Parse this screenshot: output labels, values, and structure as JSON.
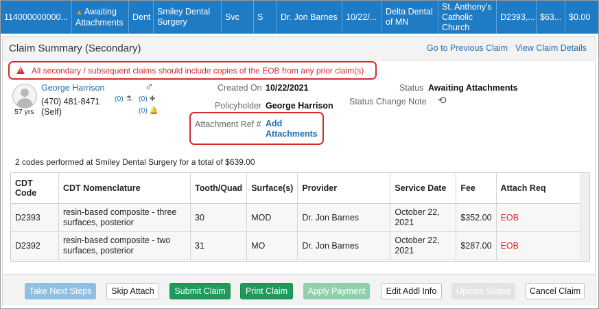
{
  "header_row": {
    "claim_no": "114000000000...",
    "status": "Awaiting Attachments",
    "type": "Dent",
    "office": "Smiley Dental Surgery",
    "svc": "Svc",
    "s": "S",
    "provider": "Dr. Jon Barnes",
    "date": "10/22/...",
    "payer": "Delta Dental of MN",
    "facility": "St. Anthony's Catholic Church",
    "codes": "D2393,...",
    "amount": "$63...",
    "balance": "$0.00"
  },
  "panel": {
    "title": "Claim Summary (Secondary)",
    "prev_link": "Go to Previous Claim",
    "details_link": "View Claim Details"
  },
  "alert": {
    "text": "All secondary / subsequent claims should include copies of the EOB from any prior claim(s)"
  },
  "patient": {
    "name": "George Harrison",
    "phone": "(470) 481-8471",
    "relation": "(Self)",
    "age": "57 yrs",
    "count1": "(0)",
    "count2": "(0)",
    "count3": "(0)",
    "gender_symbol": "♂"
  },
  "claim_info": {
    "created_label": "Created On",
    "created_value": "10/22/2021",
    "policyholder_label": "Policyholder",
    "policyholder_value": "George Harrison",
    "attachment_label": "Attachment Ref #",
    "add_attachments": "Add Attachments",
    "status_label": "Status",
    "status_value": "Awaiting Attachments",
    "status_note_label": "Status Change Note"
  },
  "summary_text": "2 codes performed at Smiley Dental Surgery for a total of $639.00",
  "table": {
    "headers": [
      "CDT Code",
      "CDT Nomenclature",
      "Tooth/Quad",
      "Surface(s)",
      "Provider",
      "Service Date",
      "Fee",
      "Attach Req"
    ],
    "rows": [
      [
        "D2393",
        "resin-based composite - three surfaces, posterior",
        "30",
        "MOD",
        "Dr. Jon Barnes",
        "October 22, 2021",
        "$352.00",
        "EOB"
      ],
      [
        "D2392",
        "resin-based composite - two surfaces, posterior",
        "31",
        "MO",
        "Dr. Jon Barnes",
        "October 22, 2021",
        "$287.00",
        "EOB"
      ]
    ]
  },
  "buttons": {
    "next_steps": "Take Next Steps",
    "skip_attach": "Skip Attach",
    "submit_claim": "Submit Claim",
    "print_claim": "Print Claim",
    "apply_payment": "Apply Payment",
    "edit_addl": "Edit Addl Info",
    "update_status": "Update Status",
    "cancel_claim": "Cancel Claim"
  },
  "colors": {
    "header_blue": "#1f7bc4",
    "alert_red": "#d42a2a",
    "green": "#1e9a5c",
    "link_blue": "#1f6fb5"
  }
}
